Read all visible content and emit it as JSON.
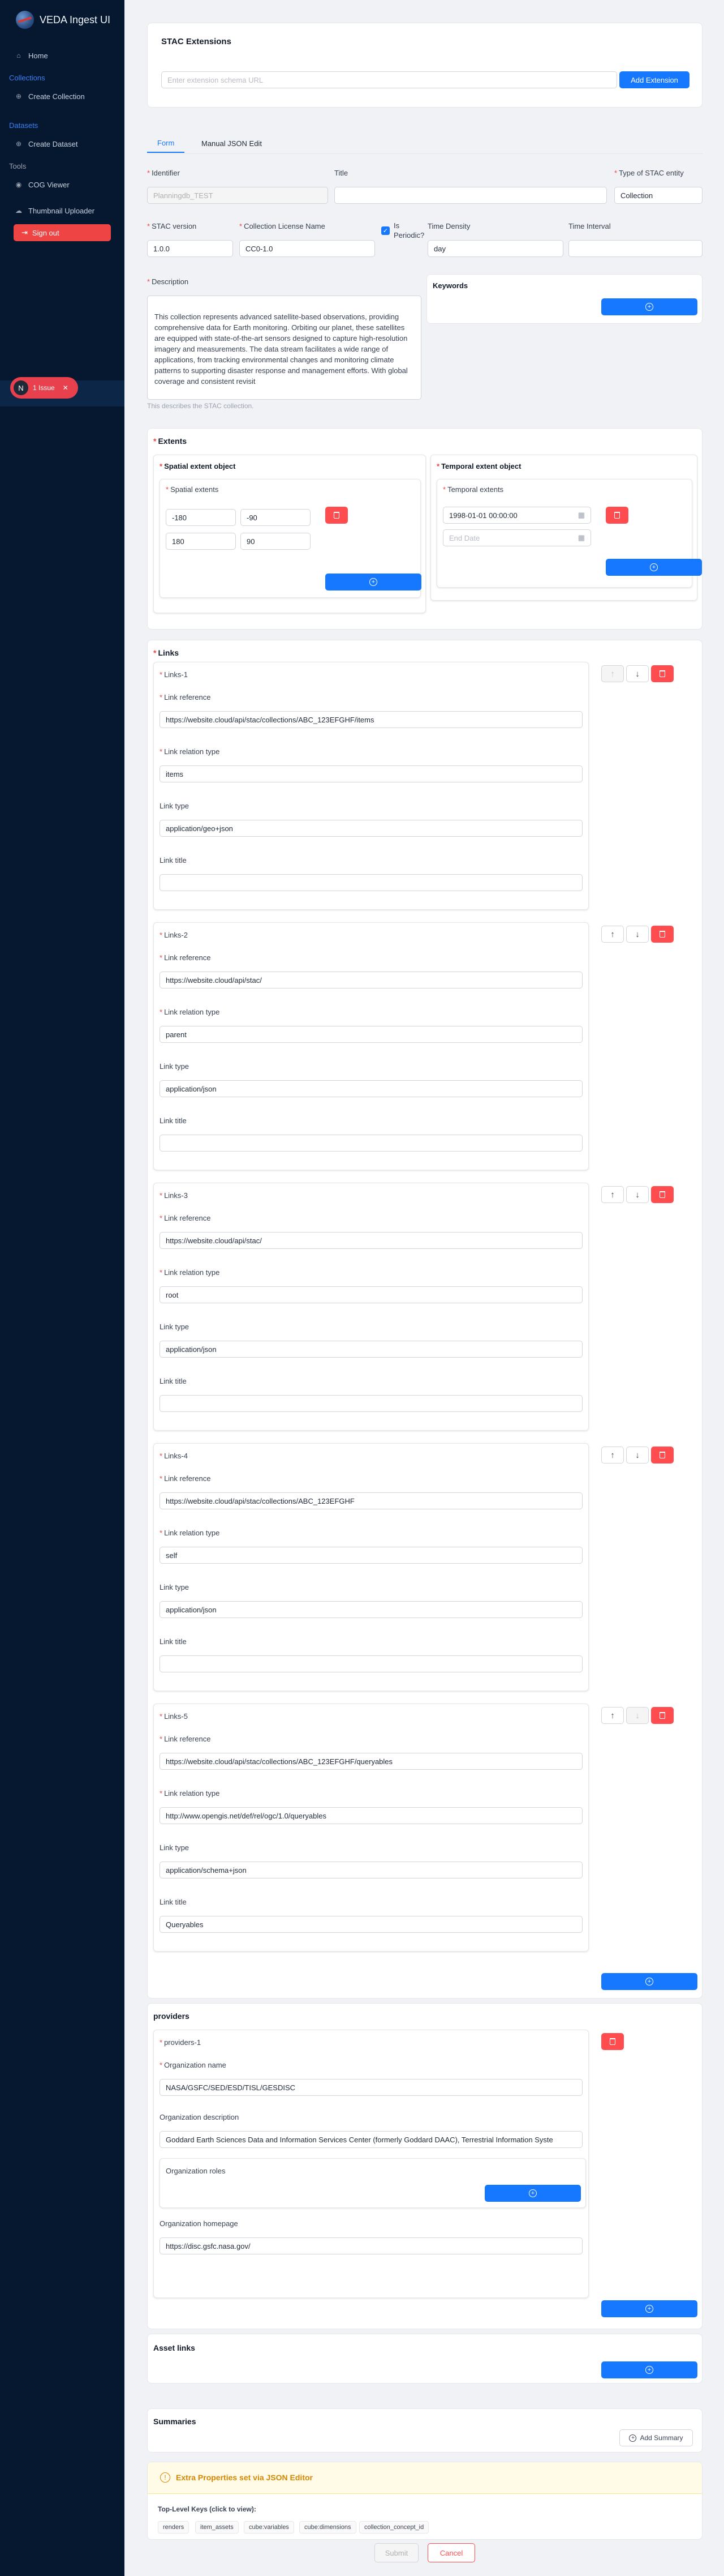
{
  "sidebar": {
    "app_title": "VEDA Ingest UI",
    "home": "Home",
    "collections_section": "Collections",
    "create_collection": "Create Collection",
    "datasets_section": "Datasets",
    "create_dataset": "Create Dataset",
    "tools_section": "Tools",
    "cog_viewer": "COG Viewer",
    "thumbnail_uploader": "Thumbnail Uploader",
    "sign_out": "Sign out",
    "issue_badge_letter": "N",
    "issue_badge_text": "1 Issue"
  },
  "extensions": {
    "title": "STAC Extensions",
    "url_placeholder": "Enter extension schema URL",
    "add_button": "Add Extension"
  },
  "tabs": [
    "Form",
    "Manual JSON Edit"
  ],
  "form": {
    "identifier_label": "Identifier",
    "identifier_value": "Planningdb_TEST",
    "title_label": "Title",
    "title_value": "",
    "type_label": "Type of STAC entity",
    "type_value": "Collection",
    "stac_version_label": "STAC version",
    "stac_version_value": "1.0.0",
    "license_label": "Collection License Name",
    "license_value": "CC0-1.0",
    "is_periodic_label": "Is Periodic?",
    "time_density_label": "Time Density",
    "time_density_value": "day",
    "time_interval_label": "Time Interval",
    "time_interval_value": "",
    "description_label": "Description",
    "description_value": "This collection represents advanced satellite-based observations, providing comprehensive data for Earth monitoring. Orbiting our planet, these satellites are equipped with state-of-the-art sensors designed to capture high-resolution imagery and measurements. The data stream facilitates a wide range of applications, from tracking environmental changes and monitoring climate patterns to supporting disaster response and management efforts. With global coverage and consistent revisit",
    "description_help": "This describes the STAC collection.",
    "keywords_label": "Keywords"
  },
  "extents": {
    "title": "Extents",
    "spatial_object_title": "Spatial extent object",
    "spatial_extents_label": "Spatial extents",
    "spatial_values": [
      "-180",
      "-90",
      "180",
      "90"
    ],
    "temporal_object_title": "Temporal extent object",
    "temporal_extents_label": "Temporal extents",
    "start_date": "1998-01-01 00:00:00",
    "end_placeholder": "End Date"
  },
  "links": {
    "title": "Links",
    "field_labels": {
      "href": "Link reference",
      "rel": "Link relation type",
      "type": "Link type",
      "title": "Link title"
    },
    "items": [
      {
        "name": "Links-1",
        "href": "https://website.cloud/api/stac/collections/ABC_123EFGHF/items",
        "rel": "items",
        "type": "application/geo+json",
        "title": ""
      },
      {
        "name": "Links-2",
        "href": "https://website.cloud/api/stac/",
        "rel": "parent",
        "type": "application/json",
        "title": ""
      },
      {
        "name": "Links-3",
        "href": "https://website.cloud/api/stac/",
        "rel": "root",
        "type": "application/json",
        "title": ""
      },
      {
        "name": "Links-4",
        "href": "https://website.cloud/api/stac/collections/ABC_123EFGHF",
        "rel": "self",
        "type": "application/json",
        "title": ""
      },
      {
        "name": "Links-5",
        "href": "https://website.cloud/api/stac/collections/ABC_123EFGHF/queryables",
        "rel": "http://www.opengis.net/def/rel/ogc/1.0/queryables",
        "type": "application/schema+json",
        "title": "Queryables"
      }
    ]
  },
  "providers": {
    "title": "providers",
    "item_title": "providers-1",
    "name_label": "Organization name",
    "name_value": "NASA/GSFC/SED/ESD/TISL/GESDISC",
    "description_label": "Organization description",
    "description_value": "Goddard Earth Sciences Data and Information Services Center (formerly Goddard DAAC), Terrestrial Information Syste",
    "roles_label": "Organization roles",
    "homepage_label": "Organization homepage",
    "homepage_value": "https://disc.gsfc.nasa.gov/"
  },
  "asset_links": {
    "title": "Asset links"
  },
  "summaries": {
    "title": "Summaries",
    "add_button": "Add Summary"
  },
  "extra": {
    "title": "Extra Properties set via JSON Editor",
    "keys_label": "Top-Level Keys (click to view):",
    "keys": [
      "renders",
      "item_assets",
      "cube:variables",
      "cube:dimensions",
      "collection_concept_id"
    ]
  },
  "actions": {
    "submit": "Submit",
    "cancel": "Cancel"
  },
  "colors": {
    "primary": "#1677ff",
    "danger": "#ff4d4f",
    "sidebar": "#061730",
    "warning_bg": "#fffbe6",
    "warning_text": "#d48806"
  }
}
